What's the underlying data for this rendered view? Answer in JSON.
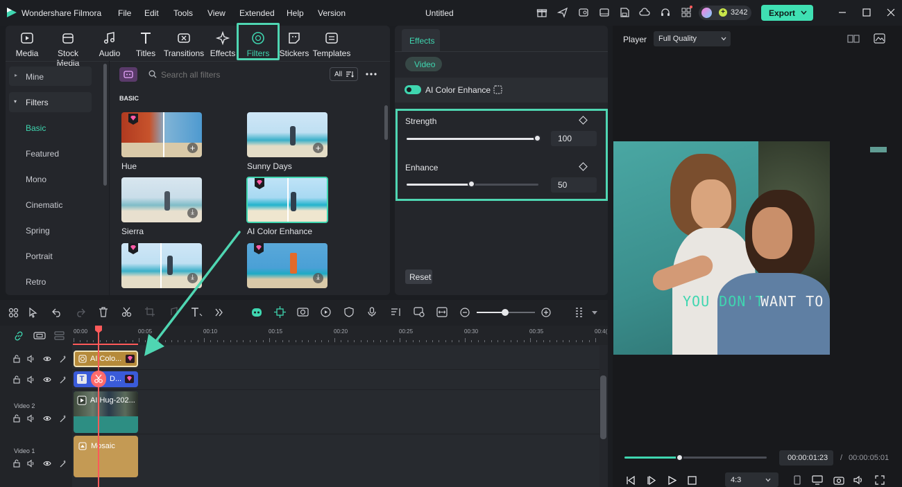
{
  "app": {
    "name": "Wondershare Filmora",
    "doc_title": "Untitled",
    "credits": "3242",
    "export_label": "Export"
  },
  "menu": [
    "File",
    "Edit",
    "Tools",
    "View",
    "Extended",
    "Help",
    "Version"
  ],
  "nav_tabs": [
    "Media",
    "Stock Media",
    "Audio",
    "Titles",
    "Transitions",
    "Effects",
    "Filters",
    "Stickers",
    "Templates"
  ],
  "sidebar": {
    "mine": "Mine",
    "filters": "Filters",
    "items": [
      "Basic",
      "Featured",
      "Mono",
      "Cinematic",
      "Spring",
      "Portrait",
      "Retro"
    ]
  },
  "search": {
    "placeholder": "Search all filters",
    "all_label": "All"
  },
  "section_label": "BASIC",
  "filters": [
    "Hue",
    "Sunny Days",
    "Sierra",
    "AI Color Enhance"
  ],
  "effects_panel": {
    "tab": "Effects",
    "subtab": "Video",
    "toggle_label": "AI Color Enhance",
    "strength_label": "Strength",
    "strength_value": "100",
    "strength_fraction": 1.0,
    "enhance_label": "Enhance",
    "enhance_value": "50",
    "enhance_fraction": 0.5,
    "reset_label": "Reset"
  },
  "player": {
    "label": "Player",
    "quality": "Full Quality",
    "caption_a": "YOU DON'T",
    "caption_b": "WANT TO BE",
    "current_time": "00:00:01:23",
    "separator": "/",
    "total_time": "00:00:05:01",
    "aspect": "4:3",
    "progress_fraction": 0.39
  },
  "timeline": {
    "ruler": [
      "00:00",
      "00:05",
      "00:10",
      "00:15",
      "00:20",
      "00:25",
      "00:30",
      "00:35",
      "00:4("
    ],
    "tracks": [
      {
        "name": "",
        "clip": "AI Colo..."
      },
      {
        "name": "",
        "clip": "D..."
      },
      {
        "name": "Video 2",
        "clip": "AI Hug-202..."
      },
      {
        "name": "Video 1",
        "clip": "Mosaic"
      }
    ]
  },
  "colors": {
    "accent": "#3fd6b0",
    "highlight_box": "#4fd6b2",
    "export_bg": "#3fe0b3",
    "clip_gold": "#b58a3a",
    "clip_blue": "#3a5bd9",
    "playhead": "#ff5a5a"
  }
}
